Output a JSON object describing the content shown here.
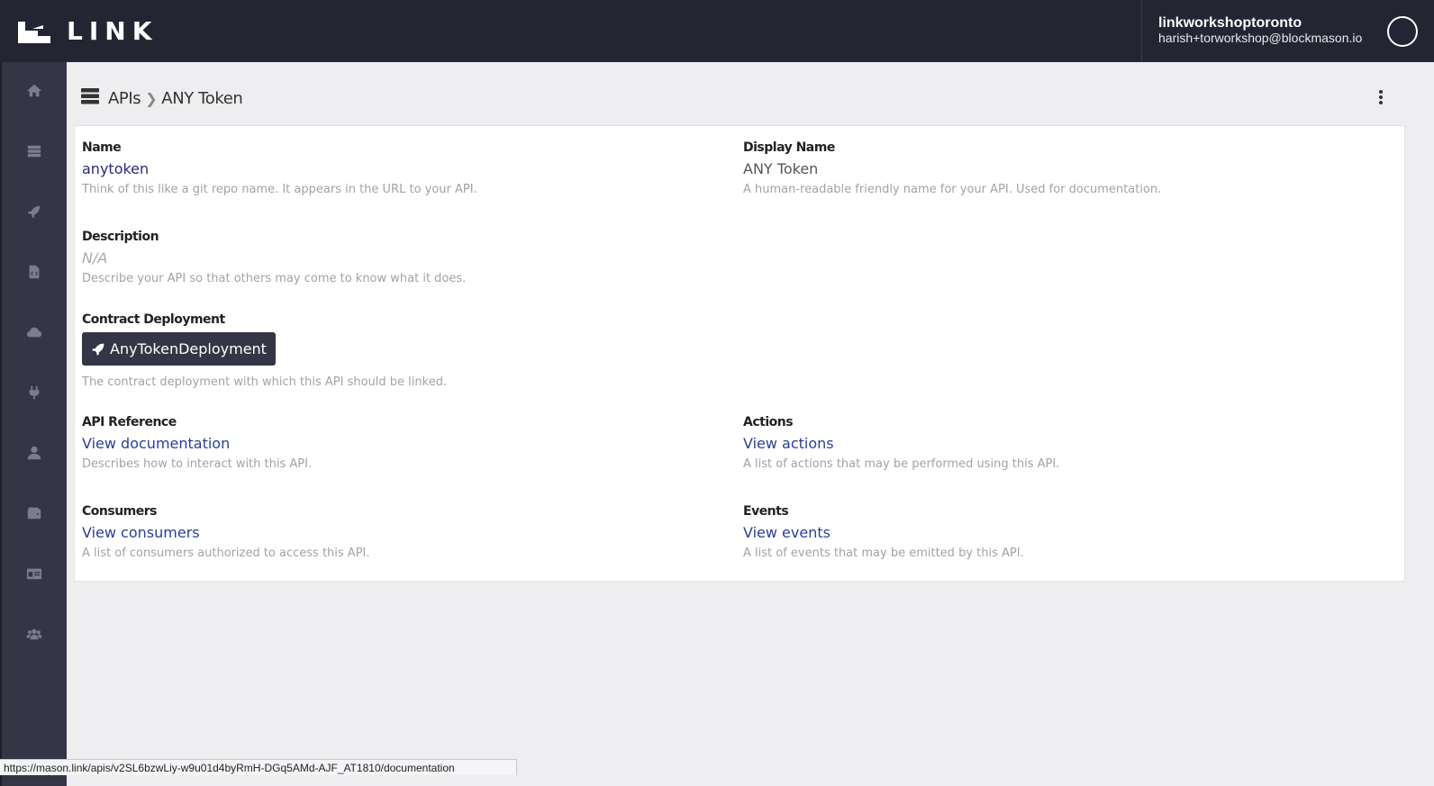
{
  "app": {
    "logo_text": "LINK",
    "account_name": "linkworkshoptoronto",
    "account_email": "harish+torworkshop@blockmason.io"
  },
  "sidebar": {
    "items": [
      {
        "icon": "home-icon"
      },
      {
        "icon": "server-icon"
      },
      {
        "icon": "rocket-icon"
      },
      {
        "icon": "code-file-icon"
      },
      {
        "icon": "cloud-icon"
      },
      {
        "icon": "plug-icon"
      },
      {
        "icon": "user-icon"
      },
      {
        "icon": "wallet-icon"
      },
      {
        "icon": "id-card-icon"
      },
      {
        "icon": "users-icon"
      }
    ]
  },
  "breadcrumb": {
    "root": "APIs",
    "separator": "❯",
    "current": "ANY Token"
  },
  "fields": {
    "name": {
      "label": "Name",
      "value": "anytoken",
      "help": "Think of this like a git repo name. It appears in the URL to your API."
    },
    "display_name": {
      "label": "Display Name",
      "value": "ANY Token",
      "help": "A human-readable friendly name for your API. Used for documentation."
    },
    "description": {
      "label": "Description",
      "value": "N/A",
      "help": "Describe your API so that others may come to know what it does."
    },
    "contract_deployment": {
      "label": "Contract Deployment",
      "value": "AnyTokenDeployment",
      "help": "The contract deployment with which this API should be linked."
    },
    "api_reference": {
      "label": "API Reference",
      "value": "View documentation",
      "help": "Describes how to interact with this API."
    },
    "actions": {
      "label": "Actions",
      "value": "View actions",
      "help": "A list of actions that may be performed using this API."
    },
    "consumers": {
      "label": "Consumers",
      "value": "View consumers",
      "help": "A list of consumers authorized to access this API."
    },
    "events": {
      "label": "Events",
      "value": "View events",
      "help": "A list of events that may be emitted by this API."
    }
  },
  "status_url": "https://mason.link/apis/v2SL6bzwLiy-w9u01d4byRmH-DGq5AMd-AJF_AT1810/documentation",
  "colors": {
    "topbar": "#232532",
    "sidebar": "#343545",
    "link": "#2a3f99"
  }
}
